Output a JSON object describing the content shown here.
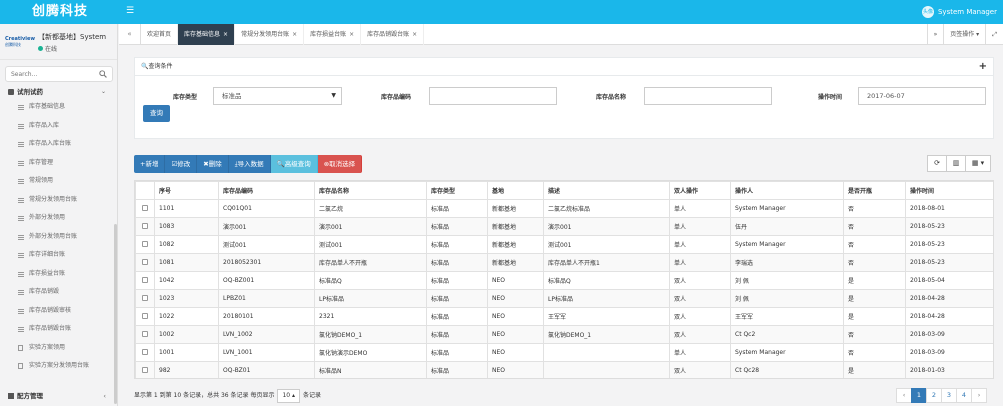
{
  "app": {
    "brand": "创腾科技",
    "menu_icon": "hamburger-icon",
    "user": "System Manager",
    "avatar_text": "头像"
  },
  "sidebar": {
    "logo_text": "Creatiview",
    "logo_sub": "创腾科技",
    "profile_name": "【新都基地】System",
    "status": "在线",
    "search_placeholder": "Search...",
    "group": "试剂试药",
    "items": [
      {
        "label": "库存基础信息",
        "icon": "list-icon"
      },
      {
        "label": "库存品入库",
        "icon": "list-icon"
      },
      {
        "label": "库存品入库台账",
        "icon": "list-icon"
      },
      {
        "label": "库存管理",
        "icon": "list-icon"
      },
      {
        "label": "常规领用",
        "icon": "list-icon"
      },
      {
        "label": "常规分发领用台账",
        "icon": "list-icon"
      },
      {
        "label": "外部分发领用",
        "icon": "list-icon"
      },
      {
        "label": "外部分发领用台账",
        "icon": "list-icon"
      },
      {
        "label": "库存详细台账",
        "icon": "list-icon"
      },
      {
        "label": "库存损益台账",
        "icon": "list-icon"
      },
      {
        "label": "库存品销毁",
        "icon": "list-icon"
      },
      {
        "label": "库存品销毁审核",
        "icon": "list-icon"
      },
      {
        "label": "库存品销毁台账",
        "icon": "list-icon"
      },
      {
        "label": "实验方案领用",
        "icon": "doc-icon"
      },
      {
        "label": "实验方案分发领用台账",
        "icon": "doc-icon"
      }
    ],
    "bottom_group": "配方管理"
  },
  "tabbar": {
    "prev": "«",
    "next": "»",
    "tabs": [
      {
        "label": "欢迎首页",
        "closable": false,
        "active": false
      },
      {
        "label": "库存基础信息",
        "closable": true,
        "active": true
      },
      {
        "label": "常规分发领用台账",
        "closable": true,
        "active": false
      },
      {
        "label": "库存损益台账",
        "closable": true,
        "active": false
      },
      {
        "label": "库存品销毁台账",
        "closable": true,
        "active": false
      }
    ],
    "page_ops": "页签操作",
    "close_sym": "×",
    "fullscreen_sym": "⤢"
  },
  "query": {
    "title": "查询条件",
    "expand": "+",
    "type_label": "库存类型",
    "type_value": "标准品",
    "code_label": "库存品编码",
    "code_value": "",
    "name_label": "库存品名称",
    "name_value": "",
    "time_label": "操作时间",
    "time_value": "2017-06-07",
    "search_button": "查询"
  },
  "toolbar": {
    "add": "+新增",
    "edit": "☑修改",
    "del": "✖删除",
    "import": "⤓导入数据",
    "advanced": "🔍高级查询",
    "cancel": "⊗取消选择",
    "refresh": "⟳",
    "columns": "▥",
    "export": "▦ ▾"
  },
  "table": {
    "headers": [
      "",
      "序号",
      "库存品编码",
      "库存品名称",
      "库存类型",
      "基地",
      "描述",
      "双人操作",
      "操作人",
      "是否开瓶",
      "操作时间"
    ],
    "rows": [
      [
        "",
        "1101",
        "CQ01Q01",
        "二氯乙烷",
        "标准品",
        "新都基地",
        "二氯乙烷标准品",
        "单人",
        "System Manager",
        "否",
        "2018-08-01"
      ],
      [
        "",
        "1083",
        "演示001",
        "演示001",
        "标准品",
        "新都基地",
        "演示001",
        "单人",
        "伍丹",
        "否",
        "2018-05-23"
      ],
      [
        "",
        "1082",
        "测试001",
        "测试001",
        "标准品",
        "新都基地",
        "测试001",
        "单人",
        "System Manager",
        "否",
        "2018-05-23"
      ],
      [
        "",
        "1081",
        "2018052301",
        "库存品单人不开瓶",
        "标准品",
        "新都基地",
        "库存品单人不开瓶1",
        "单人",
        "李瑞选",
        "否",
        "2018-05-23"
      ],
      [
        "",
        "1042",
        "OQ-BZ001",
        "标准品Q",
        "标准品",
        "NEO",
        "标准品Q",
        "双人",
        "刘 佩",
        "是",
        "2018-05-04"
      ],
      [
        "",
        "1023",
        "LPBZ01",
        "LP标准品",
        "标准品",
        "NEO",
        "LP标准品",
        "双人",
        "刘 佩",
        "是",
        "2018-04-28"
      ],
      [
        "",
        "1022",
        "20180101",
        "2321",
        "标准品",
        "NEO",
        "王军军",
        "双人",
        "王军军",
        "是",
        "2018-04-28"
      ],
      [
        "",
        "1002",
        "LVN_1002",
        "氯化钠DEMO_1",
        "标准品",
        "NEO",
        "氯化钠DEMO_1",
        "双人",
        "Ct Qc2",
        "否",
        "2018-03-09"
      ],
      [
        "",
        "1001",
        "LVN_1001",
        "氯化钠演示DEMO",
        "标准品",
        "NEO",
        "",
        "单人",
        "System Manager",
        "否",
        "2018-03-09"
      ],
      [
        "",
        "982",
        "OQ-BZ01",
        "标准品N",
        "标准品",
        "NEO",
        "",
        "双人",
        "Ct Qc28",
        "是",
        "2018-01-03"
      ]
    ]
  },
  "pagination": {
    "info_prefix": "显示第 1 到第 10 条记录，总共 36 条记录 每页显示",
    "page_size": "10 ▴",
    "info_suffix": "条记录",
    "prev": "‹",
    "pages": [
      "1",
      "2",
      "3",
      "4"
    ],
    "next": "›",
    "current": "1"
  }
}
